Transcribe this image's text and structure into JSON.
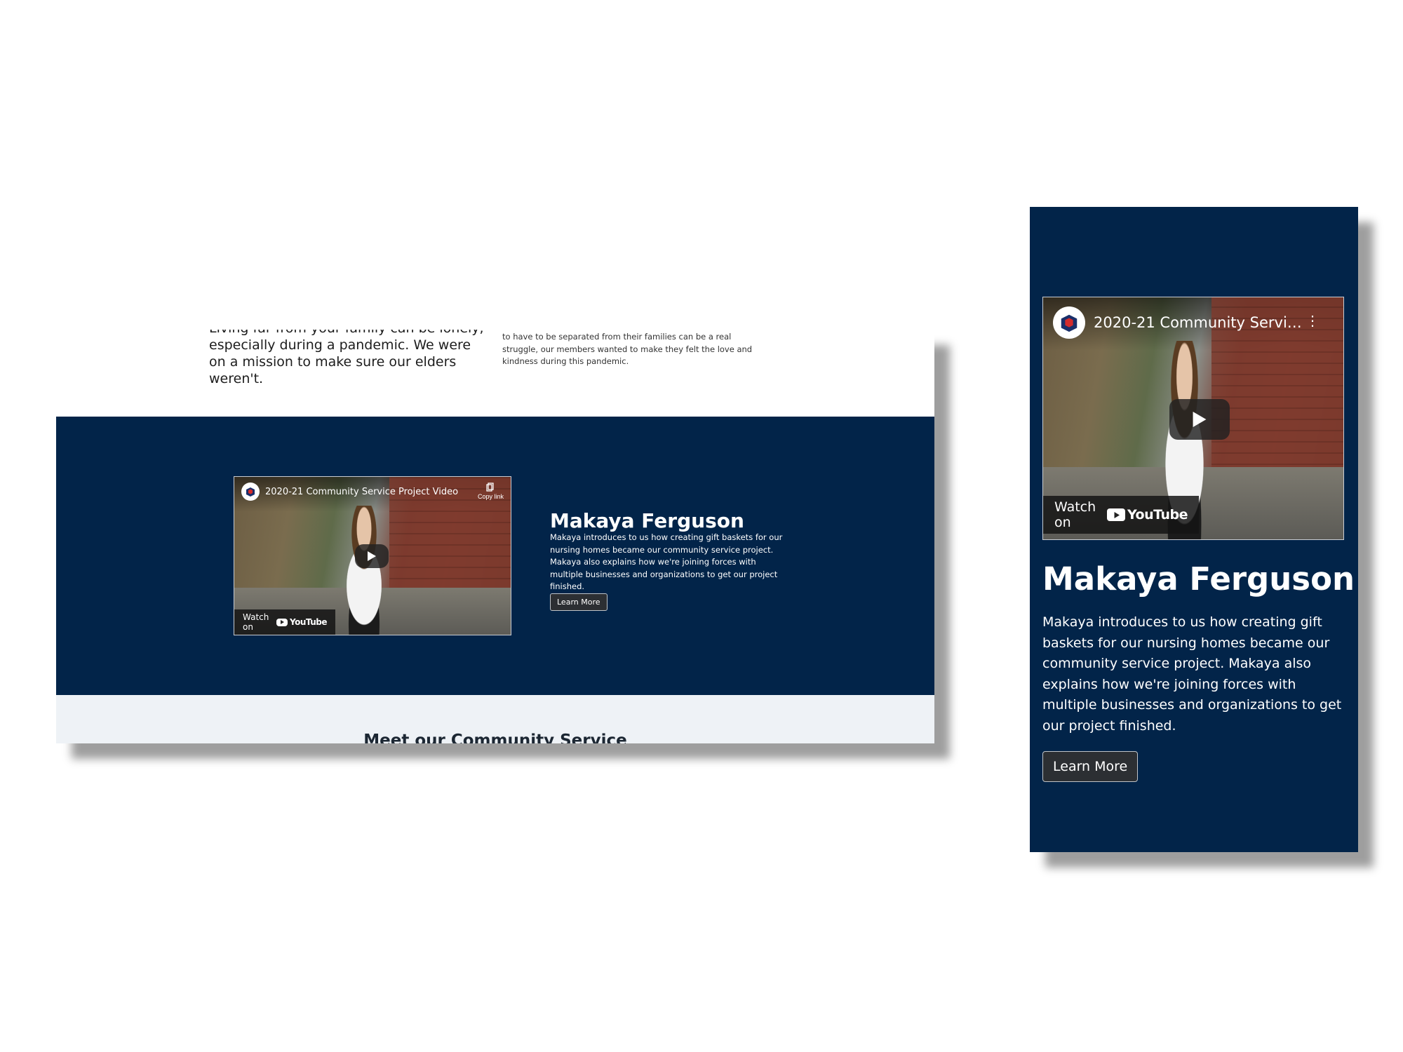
{
  "desktop": {
    "intro": {
      "left_partial_line": "Living far from your family can be lonely,",
      "left_text": "especially during a pandemic. We were on a mission to make sure our elders weren't.",
      "right_text": "to have to be separated from their families can be a real struggle, our members wanted to make they felt the love and kindness during this pandemic."
    },
    "video": {
      "title": "2020-21 Community Service Project Video",
      "copy_link": "Copy link",
      "watch_on": "Watch on",
      "youtube": "YouTube"
    },
    "profile": {
      "name": "Makaya Ferguson",
      "description": "Makaya introduces to us how creating gift baskets for our nursing homes became our community service project. Makaya also explains how we're joining forces with multiple businesses and organizations to get our project finished.",
      "button": "Learn More"
    },
    "next_section": {
      "heading_partial": "Meet our Community Service"
    }
  },
  "mobile": {
    "video": {
      "title": "2020-21 Community Servic...",
      "watch_on": "Watch on",
      "youtube": "YouTube"
    },
    "profile": {
      "name": "Makaya Ferguson",
      "description": "Makaya introduces to us how creating gift baskets for our nursing homes became our community service project. Makaya also explains how we're joining forces with multiple businesses and organizations to get our project finished.",
      "button": "Learn More"
    }
  },
  "colors": {
    "navy": "#022449",
    "light_band": "#eef2f6",
    "button_bg": "#2c2f33"
  },
  "icons": [
    "channel-logo-icon",
    "copy-link-icon",
    "play-icon",
    "youtube-logo-icon",
    "more-options-icon"
  ]
}
